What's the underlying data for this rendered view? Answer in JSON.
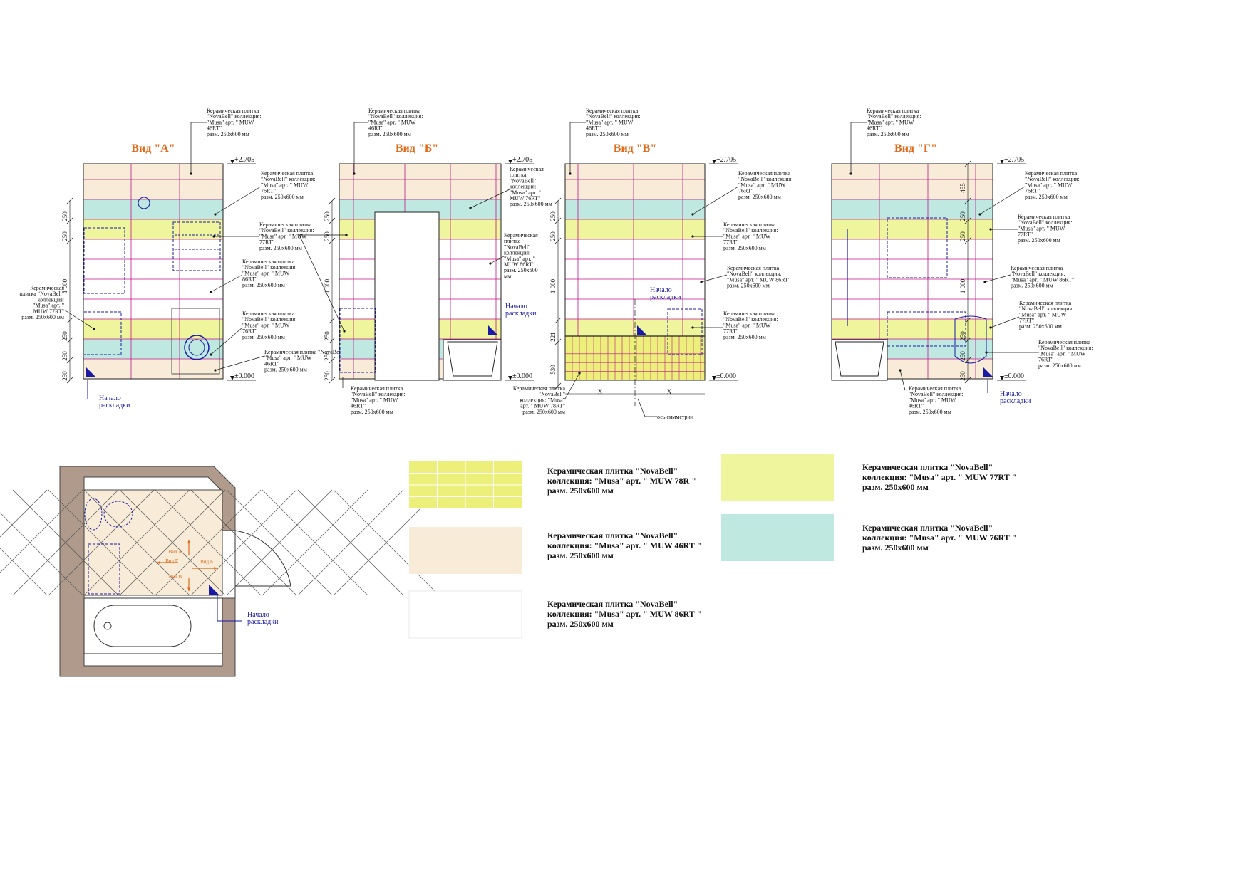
{
  "colors": {
    "t46": "#f8ecd8",
    "t77": "#eef59c",
    "t76": "#bfe9e0",
    "t86": "#ffffff",
    "t78": "#ecf07a",
    "grout": "#c0168a",
    "arrow": "#e06a1a",
    "blue": "#1a1aa6",
    "brick": "#b09a8c"
  },
  "views": [
    {
      "title": "Вид \"А\"",
      "topLevel": "+2.705",
      "bottomLevel": "±0.000",
      "dims": [
        "250",
        "250",
        "1 000",
        "250",
        "250",
        "250"
      ],
      "topNote": [
        "Керамическая плитка",
        "\"NovaBell\" коллекция:",
        "\"Musa\" арт. \" MUW",
        "46RT\"",
        "разм. 250х600 мм"
      ]
    },
    {
      "title": "Вид \"Б\"",
      "topLevel": "+2.705",
      "bottomLevel": "±0.000",
      "dims": [
        "250",
        "250",
        "1 000",
        "250",
        "250",
        "250"
      ],
      "topNote": [
        "Керамическая плитка",
        "\"NovaBell\" коллекция:",
        "\"Musa\" арт. \" MUW",
        "46RT\"",
        "разм. 250х600 мм"
      ]
    },
    {
      "title": "Вид \"В\"",
      "topLevel": "+2.705",
      "bottomLevel": "±0.000",
      "dims": [
        "250",
        "250",
        "1 000",
        "221",
        "530"
      ],
      "topNote": [
        "Керамическая плитка",
        "\"NovaBell\" коллекция:",
        "\"Musa\" арт. \" MUW",
        "46RT\"",
        "разм. 250х600 мм"
      ]
    },
    {
      "title": "Вид \"Г\"",
      "topLevel": "+2.705",
      "bottomLevel": "±0.000",
      "dims": [
        "455",
        "250",
        "250",
        "1 000",
        "250",
        "250",
        "250"
      ],
      "topNote": [
        "Керамическая плитка",
        "\"NovaBell\" коллекция:",
        "\"Musa\" арт. \" MUW",
        "46RT\"",
        "разм. 250х600 мм"
      ]
    }
  ],
  "notes": {
    "a_right": [
      [
        "Керамическая плитка",
        "\"NovaBell\" коллекция:",
        "\"Musa\" арт. \" MUW",
        "76RT\"",
        "разм. 250х600 мм"
      ],
      [
        "Керамическая плитка",
        "\"NovaBell\" коллекция:",
        "\"Musa\" арт. \" MUW",
        "77RT\"",
        "разм. 250х600 мм"
      ],
      [
        "Керамическая плитка",
        "\"NovaBell\" коллекция:",
        "\"Musa\" арт. \" MUW",
        "86RT\"",
        "разм. 250х600 мм"
      ],
      [
        "Керамическая плитка",
        "\"NovaBell\" коллекция:",
        "\"Musa\" арт. \" MUW",
        "76RT\"",
        "разм. 250х600 мм"
      ],
      [
        "Керамическая плитка \"NovaBell\" коллекция:",
        "\"Musa\" арт. \" MUW",
        "46RT\"",
        "разм. 250х600 мм"
      ]
    ],
    "a_left": [
      "Керамическая",
      "плитка \"NovaBell\"",
      "коллекция:",
      "\"Musa\" арт. \"",
      "MUW 77RT\"",
      "разм. 250х600 мм"
    ],
    "b_right": [
      [
        "Керамическая",
        "плитка",
        "\"NovaBell\"",
        "коллекция:",
        "\"Musa\" арт. \"",
        "MUW 76RT\"",
        "разм. 250х600 мм"
      ],
      [
        "Керамическая",
        "плитка",
        "\"NovaBell\"",
        "коллекция:",
        "\"Musa\" арт. \"",
        "MUW 86RT\"",
        "разм. 250х600",
        "мм"
      ]
    ],
    "b_bottom": [
      "Керамическая плитка",
      "\"NovaBell\" коллекция:",
      "\"Musa\" арт. \" MUW",
      "46RT\"",
      "разм. 250х600 мм"
    ],
    "v_bottom": [
      "Керамическая плитка",
      "\"NovaBell\"",
      "коллекция: \"Musa\"",
      "арт. \" MUW 78RT\"",
      "разм. 250х600 мм"
    ],
    "v_right": [
      [
        "Керамическая плитка",
        "\"NovaBell\" коллекция:",
        "\"Musa\" арт. \" MUW",
        "76RT\"",
        "разм. 250х600 мм"
      ],
      [
        "Керамическая плитка",
        "\"NovaBell\" коллекция:",
        "\"Musa\" арт. \" MUW",
        "77RT\"",
        "разм. 250х600 мм"
      ],
      [
        "Керамическая плитка",
        "\"NovaBell\" коллекция:",
        "\"Musa\" арт. \" MUW 86RT\"",
        "разм. 250х600 мм"
      ],
      [
        "Керамическая плитка",
        "\"NovaBell\" коллекция:",
        "\"Musa\" арт. \" MUW",
        "77RT\"",
        "разм. 250х600 мм"
      ]
    ],
    "g_right": [
      [
        "Керамическая плитка",
        "\"NovaBell\" коллекция:",
        "\"Musa\" арт. \" MUW",
        "76RT\"",
        "разм. 250х600 мм"
      ],
      [
        "Керамическая плитка",
        "\"NovaBell\" коллекция:",
        "\"Musa\" арт. \" MUW",
        "77RT\"",
        "разм. 250х600 мм"
      ],
      [
        "Керамическая плитка",
        "\"NovaBell\" коллекция:",
        "\"Musa\" арт. \" MUW 86RT\"",
        "разм. 250х600 мм"
      ],
      [
        "Керамическая плитка",
        "\"NovaBell\" коллекция:",
        "\"Musa\" арт. \" MUW",
        "77RT\"",
        "разм. 250х600 мм"
      ],
      [
        "Керамическая плитка",
        "\"NovaBell\" коллекция:",
        "\"Musa\" арт. \" MUW",
        "76RT\"",
        "разм. 250х600 мм"
      ]
    ],
    "g_bottom": [
      "Керамическая плитка",
      "\"NovaBell\" коллекция:",
      "\"Musa\" арт. \" MUW",
      "46RT\"",
      "разм. 250х600 мм"
    ],
    "start": [
      "Начало",
      "раскладки"
    ],
    "axis": "ось симметрии",
    "x": "X"
  },
  "plan": {
    "labels": {
      "a": "Вид А",
      "b": "Вид Б",
      "v": "Вид В",
      "g": "Вид Г"
    },
    "start": [
      "Начало",
      "раскладки"
    ]
  },
  "legend": [
    {
      "swatch": "t78",
      "lines": [
        "Керамическая плитка \"NovaBell\"",
        "коллекция: \"Musa\" арт. \" MUW 78R \"",
        "разм. 250х600 мм"
      ]
    },
    {
      "swatch": "t46",
      "lines": [
        "Керамическая плитка \"NovaBell\"",
        "коллекция: \"Musa\" арт. \" MUW 46RT \"",
        "разм. 250х600 мм"
      ]
    },
    {
      "swatch": "t86",
      "lines": [
        "Керамическая плитка \"NovaBell\"",
        "коллекция: \"Musa\" арт. \" MUW 86RT \"",
        "разм. 250х600 мм"
      ]
    },
    {
      "swatch": "t77",
      "lines": [
        "Керамическая плитка \"NovaBell\"",
        "коллекция: \"Musa\" арт. \" MUW 77RT \"",
        "разм. 250х600 мм"
      ]
    },
    {
      "swatch": "t76",
      "lines": [
        "Керамическая плитка \"NovaBell\"",
        "коллекция: \"Musa\" арт. \" MUW 76RT \"",
        "разм. 250х600 мм"
      ]
    }
  ]
}
